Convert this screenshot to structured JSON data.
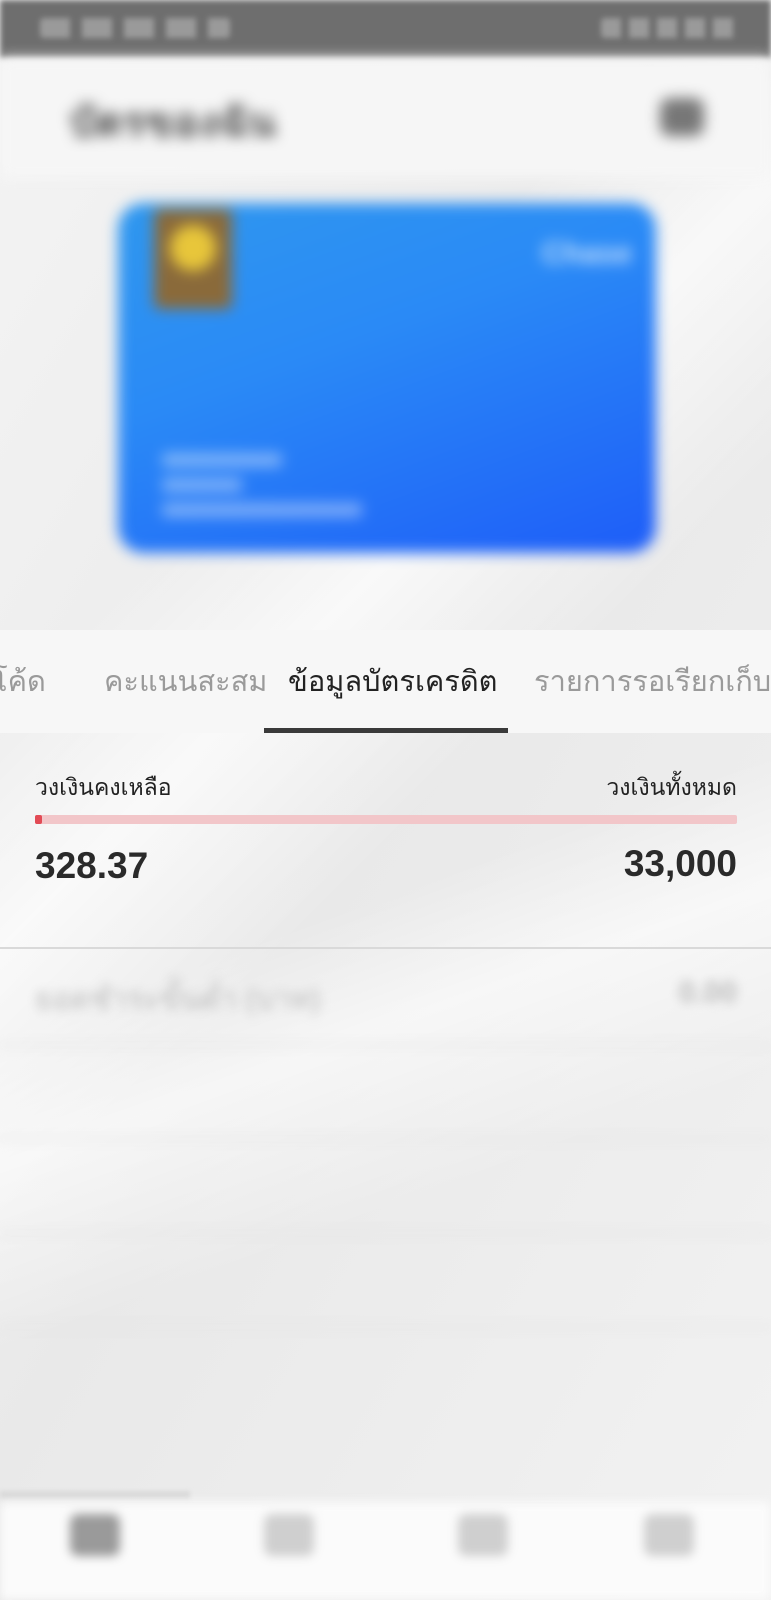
{
  "status_bar": {
    "left": "",
    "right": ""
  },
  "header": {
    "title": "บัตรของฉัน",
    "menu_icon": "menu-icon"
  },
  "card": {
    "brand": "Chase",
    "text": "",
    "caption_left": "",
    "caption_right": ""
  },
  "tabs": [
    {
      "label": "โค้ด",
      "active": false
    },
    {
      "label": "คะแนนสะสม",
      "active": false
    },
    {
      "label": "ข้อมูลบัตรเครดิต",
      "active": true
    },
    {
      "label": "รายการรอเรียกเก็บ",
      "active": false
    }
  ],
  "credit": {
    "available_label": "วงเงินคงเหลือ",
    "total_label": "วงเงินทั้งหมด",
    "available_value": "328.37",
    "total_value": "33,000",
    "used_ratio": 0.01,
    "bar_color": "#e24b55",
    "track_color": "#f2c6c9"
  },
  "details": [
    {
      "label": "ยอดชำระขั้นต่ำ (บาท)",
      "value": "0.00"
    },
    {
      "label": "",
      "value": ""
    },
    {
      "label": "",
      "value": ""
    },
    {
      "label": "",
      "value": ""
    }
  ],
  "bottom_nav": [
    {
      "label": "",
      "icon": "card-icon"
    },
    {
      "label": "",
      "icon": "gift-icon"
    },
    {
      "label": "",
      "icon": "wallet-icon"
    },
    {
      "label": "",
      "icon": "person-icon"
    }
  ]
}
